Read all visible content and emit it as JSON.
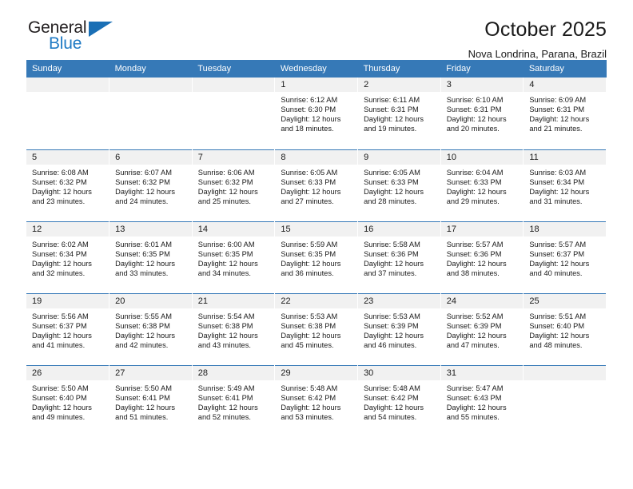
{
  "brand": {
    "line1": "General",
    "line2": "Blue",
    "accent_color": "#1a6fb5",
    "text_color": "#231f20"
  },
  "header": {
    "title": "October 2025",
    "subtitle": "Nova Londrina, Parana, Brazil",
    "header_bg": "#3679b7",
    "daynum_bg": "#f1f1f1"
  },
  "weekdays": [
    "Sunday",
    "Monday",
    "Tuesday",
    "Wednesday",
    "Thursday",
    "Friday",
    "Saturday"
  ],
  "weeks": [
    [
      {
        "day": "",
        "empty": true
      },
      {
        "day": "",
        "empty": true
      },
      {
        "day": "",
        "empty": true
      },
      {
        "day": "1",
        "sunrise": "Sunrise: 6:12 AM",
        "sunset": "Sunset: 6:30 PM",
        "daylight1": "Daylight: 12 hours",
        "daylight2": "and 18 minutes."
      },
      {
        "day": "2",
        "sunrise": "Sunrise: 6:11 AM",
        "sunset": "Sunset: 6:31 PM",
        "daylight1": "Daylight: 12 hours",
        "daylight2": "and 19 minutes."
      },
      {
        "day": "3",
        "sunrise": "Sunrise: 6:10 AM",
        "sunset": "Sunset: 6:31 PM",
        "daylight1": "Daylight: 12 hours",
        "daylight2": "and 20 minutes."
      },
      {
        "day": "4",
        "sunrise": "Sunrise: 6:09 AM",
        "sunset": "Sunset: 6:31 PM",
        "daylight1": "Daylight: 12 hours",
        "daylight2": "and 21 minutes."
      }
    ],
    [
      {
        "day": "5",
        "sunrise": "Sunrise: 6:08 AM",
        "sunset": "Sunset: 6:32 PM",
        "daylight1": "Daylight: 12 hours",
        "daylight2": "and 23 minutes."
      },
      {
        "day": "6",
        "sunrise": "Sunrise: 6:07 AM",
        "sunset": "Sunset: 6:32 PM",
        "daylight1": "Daylight: 12 hours",
        "daylight2": "and 24 minutes."
      },
      {
        "day": "7",
        "sunrise": "Sunrise: 6:06 AM",
        "sunset": "Sunset: 6:32 PM",
        "daylight1": "Daylight: 12 hours",
        "daylight2": "and 25 minutes."
      },
      {
        "day": "8",
        "sunrise": "Sunrise: 6:05 AM",
        "sunset": "Sunset: 6:33 PM",
        "daylight1": "Daylight: 12 hours",
        "daylight2": "and 27 minutes."
      },
      {
        "day": "9",
        "sunrise": "Sunrise: 6:05 AM",
        "sunset": "Sunset: 6:33 PM",
        "daylight1": "Daylight: 12 hours",
        "daylight2": "and 28 minutes."
      },
      {
        "day": "10",
        "sunrise": "Sunrise: 6:04 AM",
        "sunset": "Sunset: 6:33 PM",
        "daylight1": "Daylight: 12 hours",
        "daylight2": "and 29 minutes."
      },
      {
        "day": "11",
        "sunrise": "Sunrise: 6:03 AM",
        "sunset": "Sunset: 6:34 PM",
        "daylight1": "Daylight: 12 hours",
        "daylight2": "and 31 minutes."
      }
    ],
    [
      {
        "day": "12",
        "sunrise": "Sunrise: 6:02 AM",
        "sunset": "Sunset: 6:34 PM",
        "daylight1": "Daylight: 12 hours",
        "daylight2": "and 32 minutes."
      },
      {
        "day": "13",
        "sunrise": "Sunrise: 6:01 AM",
        "sunset": "Sunset: 6:35 PM",
        "daylight1": "Daylight: 12 hours",
        "daylight2": "and 33 minutes."
      },
      {
        "day": "14",
        "sunrise": "Sunrise: 6:00 AM",
        "sunset": "Sunset: 6:35 PM",
        "daylight1": "Daylight: 12 hours",
        "daylight2": "and 34 minutes."
      },
      {
        "day": "15",
        "sunrise": "Sunrise: 5:59 AM",
        "sunset": "Sunset: 6:35 PM",
        "daylight1": "Daylight: 12 hours",
        "daylight2": "and 36 minutes."
      },
      {
        "day": "16",
        "sunrise": "Sunrise: 5:58 AM",
        "sunset": "Sunset: 6:36 PM",
        "daylight1": "Daylight: 12 hours",
        "daylight2": "and 37 minutes."
      },
      {
        "day": "17",
        "sunrise": "Sunrise: 5:57 AM",
        "sunset": "Sunset: 6:36 PM",
        "daylight1": "Daylight: 12 hours",
        "daylight2": "and 38 minutes."
      },
      {
        "day": "18",
        "sunrise": "Sunrise: 5:57 AM",
        "sunset": "Sunset: 6:37 PM",
        "daylight1": "Daylight: 12 hours",
        "daylight2": "and 40 minutes."
      }
    ],
    [
      {
        "day": "19",
        "sunrise": "Sunrise: 5:56 AM",
        "sunset": "Sunset: 6:37 PM",
        "daylight1": "Daylight: 12 hours",
        "daylight2": "and 41 minutes."
      },
      {
        "day": "20",
        "sunrise": "Sunrise: 5:55 AM",
        "sunset": "Sunset: 6:38 PM",
        "daylight1": "Daylight: 12 hours",
        "daylight2": "and 42 minutes."
      },
      {
        "day": "21",
        "sunrise": "Sunrise: 5:54 AM",
        "sunset": "Sunset: 6:38 PM",
        "daylight1": "Daylight: 12 hours",
        "daylight2": "and 43 minutes."
      },
      {
        "day": "22",
        "sunrise": "Sunrise: 5:53 AM",
        "sunset": "Sunset: 6:38 PM",
        "daylight1": "Daylight: 12 hours",
        "daylight2": "and 45 minutes."
      },
      {
        "day": "23",
        "sunrise": "Sunrise: 5:53 AM",
        "sunset": "Sunset: 6:39 PM",
        "daylight1": "Daylight: 12 hours",
        "daylight2": "and 46 minutes."
      },
      {
        "day": "24",
        "sunrise": "Sunrise: 5:52 AM",
        "sunset": "Sunset: 6:39 PM",
        "daylight1": "Daylight: 12 hours",
        "daylight2": "and 47 minutes."
      },
      {
        "day": "25",
        "sunrise": "Sunrise: 5:51 AM",
        "sunset": "Sunset: 6:40 PM",
        "daylight1": "Daylight: 12 hours",
        "daylight2": "and 48 minutes."
      }
    ],
    [
      {
        "day": "26",
        "sunrise": "Sunrise: 5:50 AM",
        "sunset": "Sunset: 6:40 PM",
        "daylight1": "Daylight: 12 hours",
        "daylight2": "and 49 minutes."
      },
      {
        "day": "27",
        "sunrise": "Sunrise: 5:50 AM",
        "sunset": "Sunset: 6:41 PM",
        "daylight1": "Daylight: 12 hours",
        "daylight2": "and 51 minutes."
      },
      {
        "day": "28",
        "sunrise": "Sunrise: 5:49 AM",
        "sunset": "Sunset: 6:41 PM",
        "daylight1": "Daylight: 12 hours",
        "daylight2": "and 52 minutes."
      },
      {
        "day": "29",
        "sunrise": "Sunrise: 5:48 AM",
        "sunset": "Sunset: 6:42 PM",
        "daylight1": "Daylight: 12 hours",
        "daylight2": "and 53 minutes."
      },
      {
        "day": "30",
        "sunrise": "Sunrise: 5:48 AM",
        "sunset": "Sunset: 6:42 PM",
        "daylight1": "Daylight: 12 hours",
        "daylight2": "and 54 minutes."
      },
      {
        "day": "31",
        "sunrise": "Sunrise: 5:47 AM",
        "sunset": "Sunset: 6:43 PM",
        "daylight1": "Daylight: 12 hours",
        "daylight2": "and 55 minutes."
      },
      {
        "day": "",
        "empty": true
      }
    ]
  ]
}
